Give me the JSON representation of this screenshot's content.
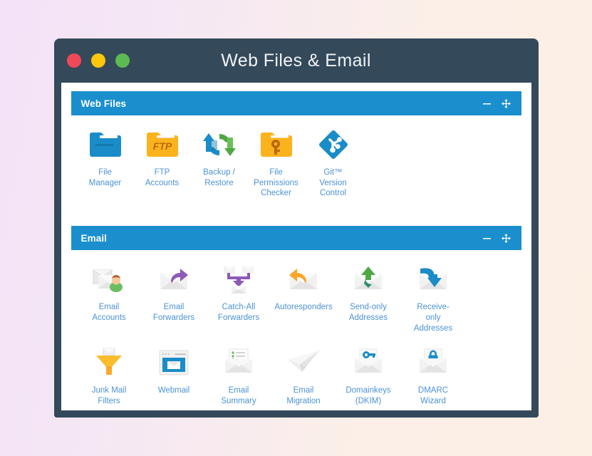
{
  "window": {
    "title": "Web Files & Email",
    "traffic_lights": [
      {
        "name": "close",
        "color": "#ef4957"
      },
      {
        "name": "minimize",
        "color": "#fdc70a"
      },
      {
        "name": "maximize",
        "color": "#5cba52"
      }
    ],
    "chrome_color": "#34495a"
  },
  "theme": {
    "panel_header_bg": "#1b8fce",
    "label_color": "#4b92d4",
    "card_bg": "#ffffff",
    "bg_gradient_start": "#f3e2f8",
    "bg_gradient_end": "#fcefe4"
  },
  "panels": [
    {
      "id": "web-files",
      "title": "Web Files",
      "actions": [
        {
          "name": "collapse",
          "icon": "minus-icon"
        },
        {
          "name": "move",
          "icon": "move-arrows-icon"
        }
      ],
      "items": [
        {
          "id": "file-manager",
          "label": "File\nManager",
          "icon": "folder-blue-icon"
        },
        {
          "id": "ftp-accounts",
          "label": "FTP\nAccounts",
          "icon": "folder-ftp-icon"
        },
        {
          "id": "backup-restore",
          "label": "Backup /\nRestore",
          "icon": "sync-arrows-icon"
        },
        {
          "id": "file-permissions",
          "label": "File\nPermissions\nChecker",
          "icon": "folder-key-icon"
        },
        {
          "id": "git-version-control",
          "label": "Git™\nVersion\nControl",
          "icon": "git-icon"
        }
      ]
    },
    {
      "id": "email",
      "title": "Email",
      "actions": [
        {
          "name": "collapse",
          "icon": "minus-icon"
        },
        {
          "name": "move",
          "icon": "move-arrows-icon"
        }
      ],
      "items": [
        {
          "id": "email-accounts",
          "label": "Email\nAccounts",
          "icon": "envelopes-user-icon"
        },
        {
          "id": "email-forwarders",
          "label": "Email\nForwarders",
          "icon": "envelope-purple-arrow-icon"
        },
        {
          "id": "catch-all",
          "label": "Catch-All\nForwarders",
          "icon": "envelopes-merge-icon"
        },
        {
          "id": "autoresponders",
          "label": "Autoresponders",
          "icon": "envelope-orange-arrow-icon"
        },
        {
          "id": "send-only",
          "label": "Send-only\nAddresses",
          "icon": "envelope-green-up-icon"
        },
        {
          "id": "receive-only",
          "label": "Receive-\nonly\nAddresses",
          "icon": "envelope-blue-down-icon"
        },
        {
          "id": "junk-mail-filters",
          "label": "Junk Mail\nFilters",
          "icon": "funnel-icon"
        },
        {
          "id": "webmail",
          "label": "Webmail",
          "icon": "browser-mail-icon"
        },
        {
          "id": "email-summary",
          "label": "Email\nSummary",
          "icon": "envelope-list-icon"
        },
        {
          "id": "email-migration",
          "label": "Email\nMigration",
          "icon": "paper-plane-icon"
        },
        {
          "id": "domainkeys-dkim",
          "label": "Domainkeys\n(DKIM)",
          "icon": "envelope-key-icon"
        },
        {
          "id": "dmarc-wizard",
          "label": "DMARC\nWizard",
          "icon": "envelope-lock-icon"
        }
      ]
    }
  ]
}
